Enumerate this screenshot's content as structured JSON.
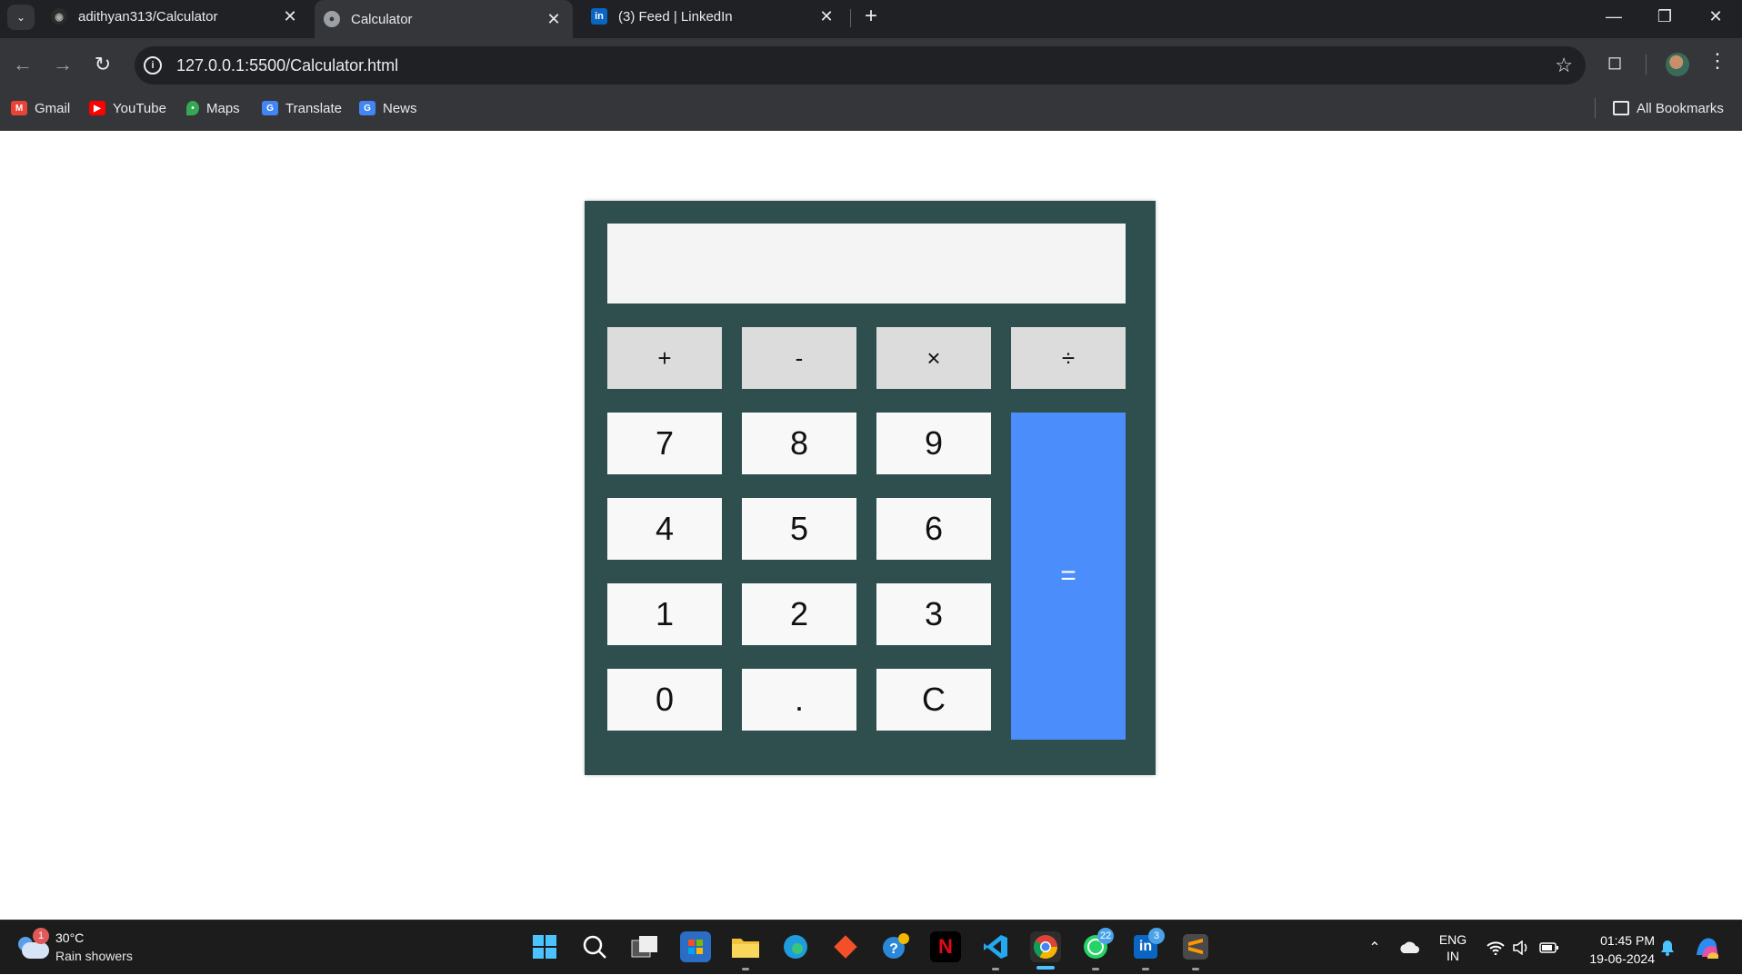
{
  "browser": {
    "tab_menu_icon": "chevron-down-icon",
    "tabs": [
      {
        "title": "adithyan313/Calculator",
        "icon": "github-icon",
        "active": false
      },
      {
        "title": "Calculator",
        "icon": "globe-icon",
        "active": true
      },
      {
        "title": "(3) Feed | LinkedIn",
        "icon": "linkedin-icon",
        "active": false
      }
    ],
    "new_tab": "+",
    "url": "127.0.0.1:5500/Calculator.html",
    "bookmarks": [
      {
        "label": "Gmail",
        "icon": "gmail-icon"
      },
      {
        "label": "YouTube",
        "icon": "youtube-icon"
      },
      {
        "label": "Maps",
        "icon": "maps-icon"
      },
      {
        "label": "Translate",
        "icon": "translate-icon"
      },
      {
        "label": "News",
        "icon": "news-icon"
      }
    ],
    "all_bookmarks": "All Bookmarks"
  },
  "calculator": {
    "display_value": "",
    "operators": [
      "+",
      "-",
      "×",
      "÷"
    ],
    "rows": [
      [
        "7",
        "8",
        "9"
      ],
      [
        "4",
        "5",
        "6"
      ],
      [
        "1",
        "2",
        "3"
      ],
      [
        "0",
        ".",
        "C"
      ]
    ],
    "equals": "=",
    "colors": {
      "body": "#2f4f4f",
      "display": "#f4f4f4",
      "operator_key": "#dcdcdc",
      "number_key": "#f8f8f8",
      "equals_key": "#4a8dfb"
    }
  },
  "taskbar": {
    "weather": {
      "badge": "1",
      "temperature": "30°C",
      "description": "Rain showers"
    },
    "apps": [
      {
        "name": "start",
        "icon": "windows-start-icon"
      },
      {
        "name": "search",
        "icon": "search-icon"
      },
      {
        "name": "task-view",
        "icon": "task-view-icon"
      },
      {
        "name": "store",
        "icon": "microsoft-store-icon"
      },
      {
        "name": "file-explorer",
        "icon": "folder-icon"
      },
      {
        "name": "edge",
        "icon": "edge-icon"
      },
      {
        "name": "git",
        "icon": "git-icon"
      },
      {
        "name": "help",
        "icon": "help-icon"
      },
      {
        "name": "netflix",
        "icon": "netflix-icon"
      },
      {
        "name": "vscode",
        "icon": "vscode-icon"
      },
      {
        "name": "chrome",
        "icon": "chrome-icon"
      },
      {
        "name": "whatsapp",
        "icon": "whatsapp-icon",
        "badge": "22"
      },
      {
        "name": "linkedin",
        "icon": "linkedin-icon",
        "badge": "3"
      },
      {
        "name": "sublime",
        "icon": "sublime-text-icon"
      }
    ],
    "language": {
      "line1": "ENG",
      "line2": "IN"
    },
    "time": "01:45 PM",
    "date": "19-06-2024"
  }
}
